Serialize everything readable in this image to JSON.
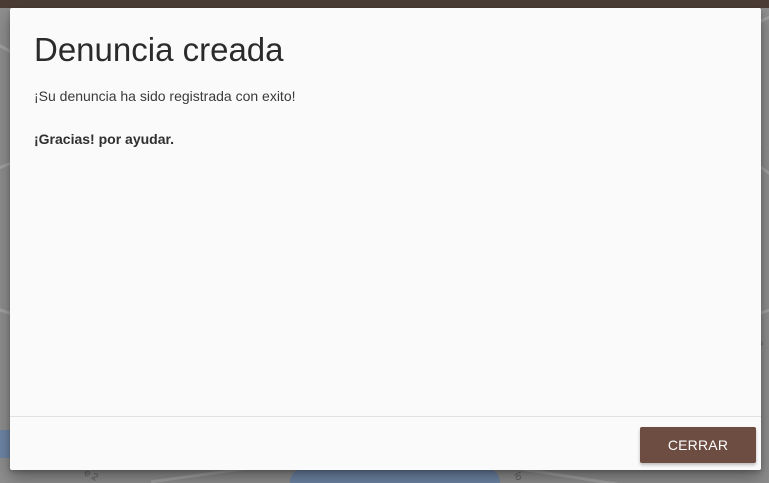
{
  "modal": {
    "title": "Denuncia creada",
    "message": "¡Su denuncia ha sido registrada con exito!",
    "thanks": "¡Gracias! por ayudar.",
    "close_label": "CERRAR"
  },
  "colors": {
    "topbar": "#4b3d36",
    "overlay": "#8f8f8f",
    "modal_background": "#fafafa",
    "button_background": "#6d4c41",
    "button_text": "#ffffff"
  }
}
